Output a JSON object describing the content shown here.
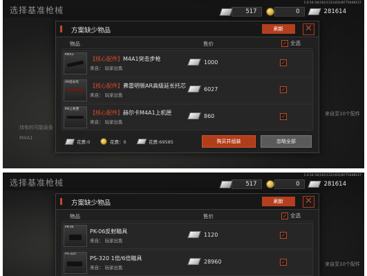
{
  "background": {
    "title": "选择基准枪械",
    "version": "1.0.54.54(10)(1121)03)(8775448127",
    "side_label": "持有的可能装备",
    "side_sub": "M4A1",
    "right_note": "来自至10个配件"
  },
  "currencies": [
    {
      "icon": "cash-icon",
      "value": "517"
    },
    {
      "icon": "coin-icon",
      "value": "0"
    },
    {
      "icon": "bill-icon",
      "value": "281614"
    }
  ],
  "dialog": {
    "title": "方案缺少物品",
    "refresh_label": "刷新",
    "close_symbol": "✕",
    "col_item": "物品",
    "col_price": "售价",
    "col_select_all": "全选"
  },
  "items": [
    {
      "thumb_label": "M4A1",
      "core_tag": "【核心配件】",
      "name": "M4A1突击步枪",
      "source": "来自：  玩家出售",
      "price": "1000",
      "checked": true
    },
    {
      "thumb_label": "AR延长托",
      "core_tag": "【核心配件】",
      "name": "弗雷明顿AR高级延长托芯",
      "source": "来自：  玩家出售",
      "price": "6027",
      "checked": true
    },
    {
      "thumb_label": "M4上机匣",
      "core_tag": "【核心配件】",
      "name": "赫尔卡M4A1上机匣",
      "source": "来自：  玩家出售",
      "price": "860",
      "checked": true
    }
  ],
  "footer": {
    "cost1": "花费:0",
    "cost2": "花费：0",
    "cost3": "花费:69585",
    "buy_label": "购买并组装",
    "ignore_label": "忽略全部"
  },
  "items2": [
    {
      "thumb_label": "PK-06",
      "name": "PK-06反射瞄具",
      "source": "来自：  玩家出售",
      "price": "1120",
      "checked": true
    },
    {
      "thumb_label": "PS-320",
      "name": "PS-320 1倍/6倍瞄具",
      "source": "来自：  玩家出售",
      "price": "28960",
      "checked": true
    }
  ],
  "colors": {
    "accent": "#b43f1e",
    "panel": "#202020",
    "text": "#e3e3e3"
  }
}
